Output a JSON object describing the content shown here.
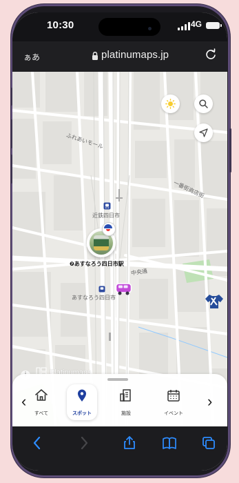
{
  "status_bar": {
    "time": "10:30",
    "network": "4G"
  },
  "browser": {
    "reader_label": "ぁあ",
    "url": "platinumaps.jp"
  },
  "map": {
    "labels": {
      "street_north": "ふれあいモール",
      "kintetsu_station": "近鉄四日市",
      "selected_station": "❼あすなろう四日市駅",
      "central_street": "中央通",
      "small_station": "あすなろう四日市",
      "shopping_street": "一番街商店街"
    },
    "brand": "Platinumaps"
  },
  "categories": {
    "previous": "‹",
    "next": "›",
    "items": [
      {
        "label": "すべて",
        "icon": "home-icon"
      },
      {
        "label": "スポット",
        "icon": "location-pin-icon"
      },
      {
        "label": "施設",
        "icon": "building-icon"
      },
      {
        "label": "イベント",
        "icon": "calendar-icon"
      }
    ]
  },
  "colors": {
    "accent": "#1f3f9f",
    "toolbar_blue": "#2d8cff",
    "sun": "#f7cd2f"
  }
}
